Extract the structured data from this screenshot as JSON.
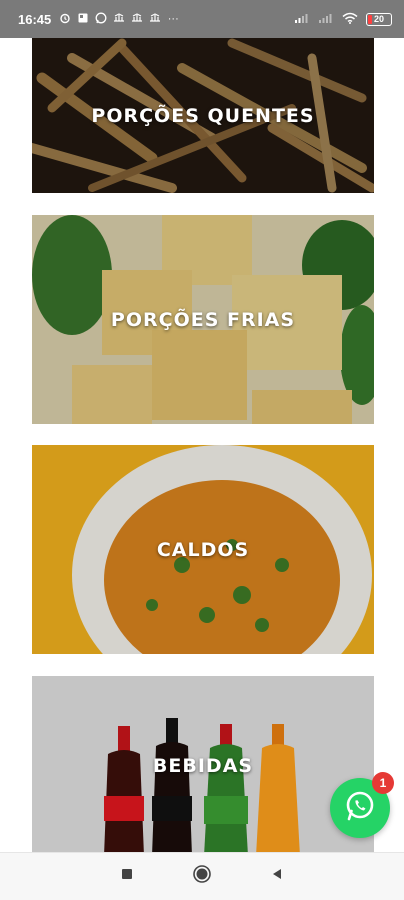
{
  "status_bar": {
    "time": "16:45",
    "notifications": [
      "alarm-icon",
      "news-icon",
      "whatsapp-icon",
      "app-icon",
      "app-icon",
      "app-icon"
    ],
    "more": "···",
    "battery_level": "20"
  },
  "categories": [
    {
      "label": "PORÇÕES QUENTES"
    },
    {
      "label": "PORÇÕES FRIAS"
    },
    {
      "label": "CALDOS"
    },
    {
      "label": "BEBIDAS"
    }
  ],
  "fab": {
    "icon": "whatsapp-icon",
    "badge": "1",
    "color": "#25d366"
  },
  "nav": {
    "buttons": [
      "recents-icon",
      "home-icon",
      "back-icon"
    ]
  },
  "colors": {
    "status_bar": "#7a7a7a",
    "badge": "#e53935",
    "whatsapp": "#25d366"
  }
}
